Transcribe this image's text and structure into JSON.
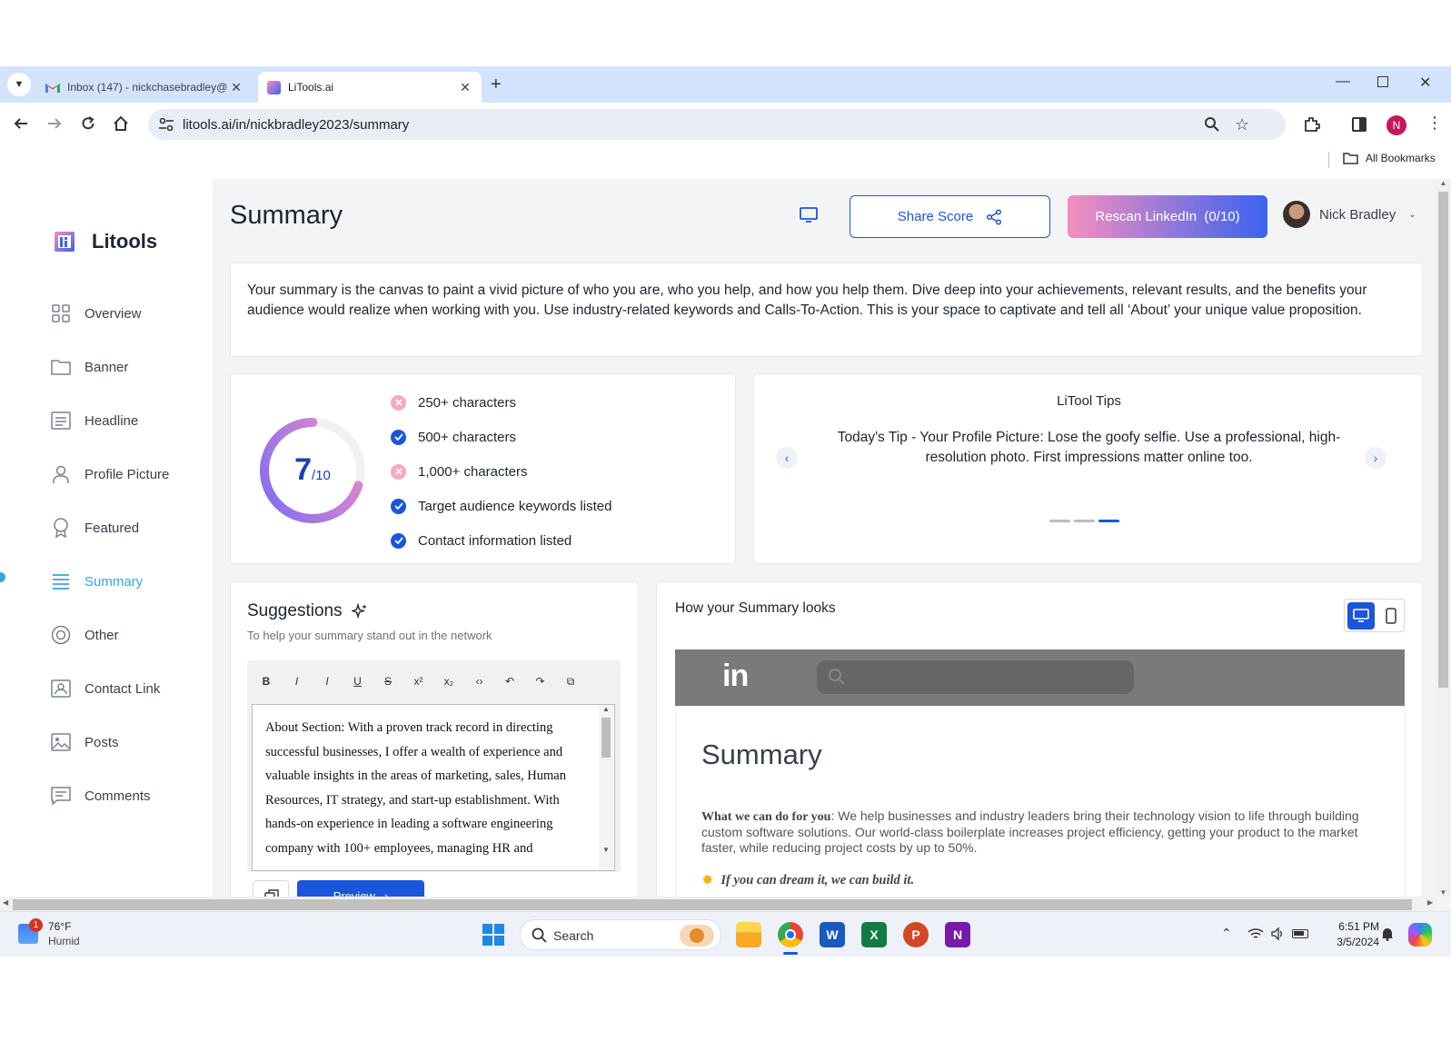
{
  "browser": {
    "tabs": [
      {
        "title": "Inbox (147) - nickchasebradley@",
        "icon": "gmail-icon",
        "active": false
      },
      {
        "title": "LiTools.ai",
        "icon": "litools-favicon-icon",
        "active": true
      }
    ],
    "url": "litools.ai/in/nickbradley2023/summary",
    "profile_initial": "N",
    "bookmarks_label": "All Bookmarks"
  },
  "sidebar": {
    "logo_text": "Litools",
    "items": [
      {
        "label": "Overview",
        "icon": "grid-icon"
      },
      {
        "label": "Banner",
        "icon": "folder-icon"
      },
      {
        "label": "Headline",
        "icon": "text-lines-icon"
      },
      {
        "label": "Profile Picture",
        "icon": "person-icon"
      },
      {
        "label": "Featured",
        "icon": "award-icon"
      },
      {
        "label": "Summary",
        "icon": "list-icon",
        "active": true
      },
      {
        "label": "Other",
        "icon": "target-icon"
      },
      {
        "label": "Contact Link",
        "icon": "contact-card-icon"
      },
      {
        "label": "Posts",
        "icon": "image-icon"
      },
      {
        "label": "Comments",
        "icon": "comment-icon"
      }
    ]
  },
  "header": {
    "title": "Summary",
    "share_label": "Share Score",
    "rescan_label": "Rescan LinkedIn  (0/10)",
    "user_name": "Nick Bradley"
  },
  "intro": "Your summary is the canvas to paint a vivid picture of who you are, who you help, and how you help them. Dive deep into your achievements, relevant results, and the benefits your audience would realize when working with you. Use industry-related keywords and Calls-To-Action. This is your space to captivate and tell all ‘About’ your unique value proposition.",
  "score": {
    "value": "7",
    "out_of": "/10",
    "fraction": 0.7,
    "checks": [
      {
        "label": "250+ characters",
        "passed": false
      },
      {
        "label": "500+ characters",
        "passed": true
      },
      {
        "label": "1,000+ characters",
        "passed": false
      },
      {
        "label": "Target audience keywords listed",
        "passed": true
      },
      {
        "label": "Contact information listed",
        "passed": true
      }
    ]
  },
  "tips": {
    "title": "LiTool Tips",
    "text": "Today's Tip - Your Profile Picture: Lose the goofy selfie. Use a professional, high-resolution photo. First impressions matter online too.",
    "active_index": 2,
    "count": 3
  },
  "suggestions": {
    "title": "Suggestions",
    "subtitle": "To help your summary stand out in the network",
    "toolbar": [
      "B",
      "I",
      "I",
      "U",
      "S",
      "x²",
      "x₂",
      "‹›",
      "↶",
      "↷",
      "⧉"
    ],
    "editor_text": "About Section: With a proven track record in directing successful businesses, I offer a wealth of experience and valuable insights in the areas of marketing, sales, Human Resources, IT strategy, and start-up establishment. With hands-on experience in leading a software engineering company with 100+ employees, managing HR and",
    "preview_label": "Preview"
  },
  "preview": {
    "title": "How your Summary looks",
    "linkedin_logo": "in",
    "section_title": "Summary",
    "bold_lead": "What we can do for you",
    "body": ": We help businesses and industry leaders bring their technology vision to life through building custom software solutions. Our world-class boilerplate increases project efficiency, getting your product to the market faster, while reducing project costs by up to 50%.",
    "tagline": "If you can dream it, we can build it."
  },
  "taskbar": {
    "weather_temp": "76°F",
    "weather_desc": "Humid",
    "weather_badge": "1",
    "search_label": "Search",
    "time": "6:51 PM",
    "date": "3/5/2024"
  },
  "colors": {
    "accent_blue": "#1a56db",
    "active_nav": "#3aa3e3",
    "fail_pink": "#f7a8c4",
    "rescan_gradient_start": "#f58fbf",
    "rescan_gradient_end": "#3a63f0"
  }
}
